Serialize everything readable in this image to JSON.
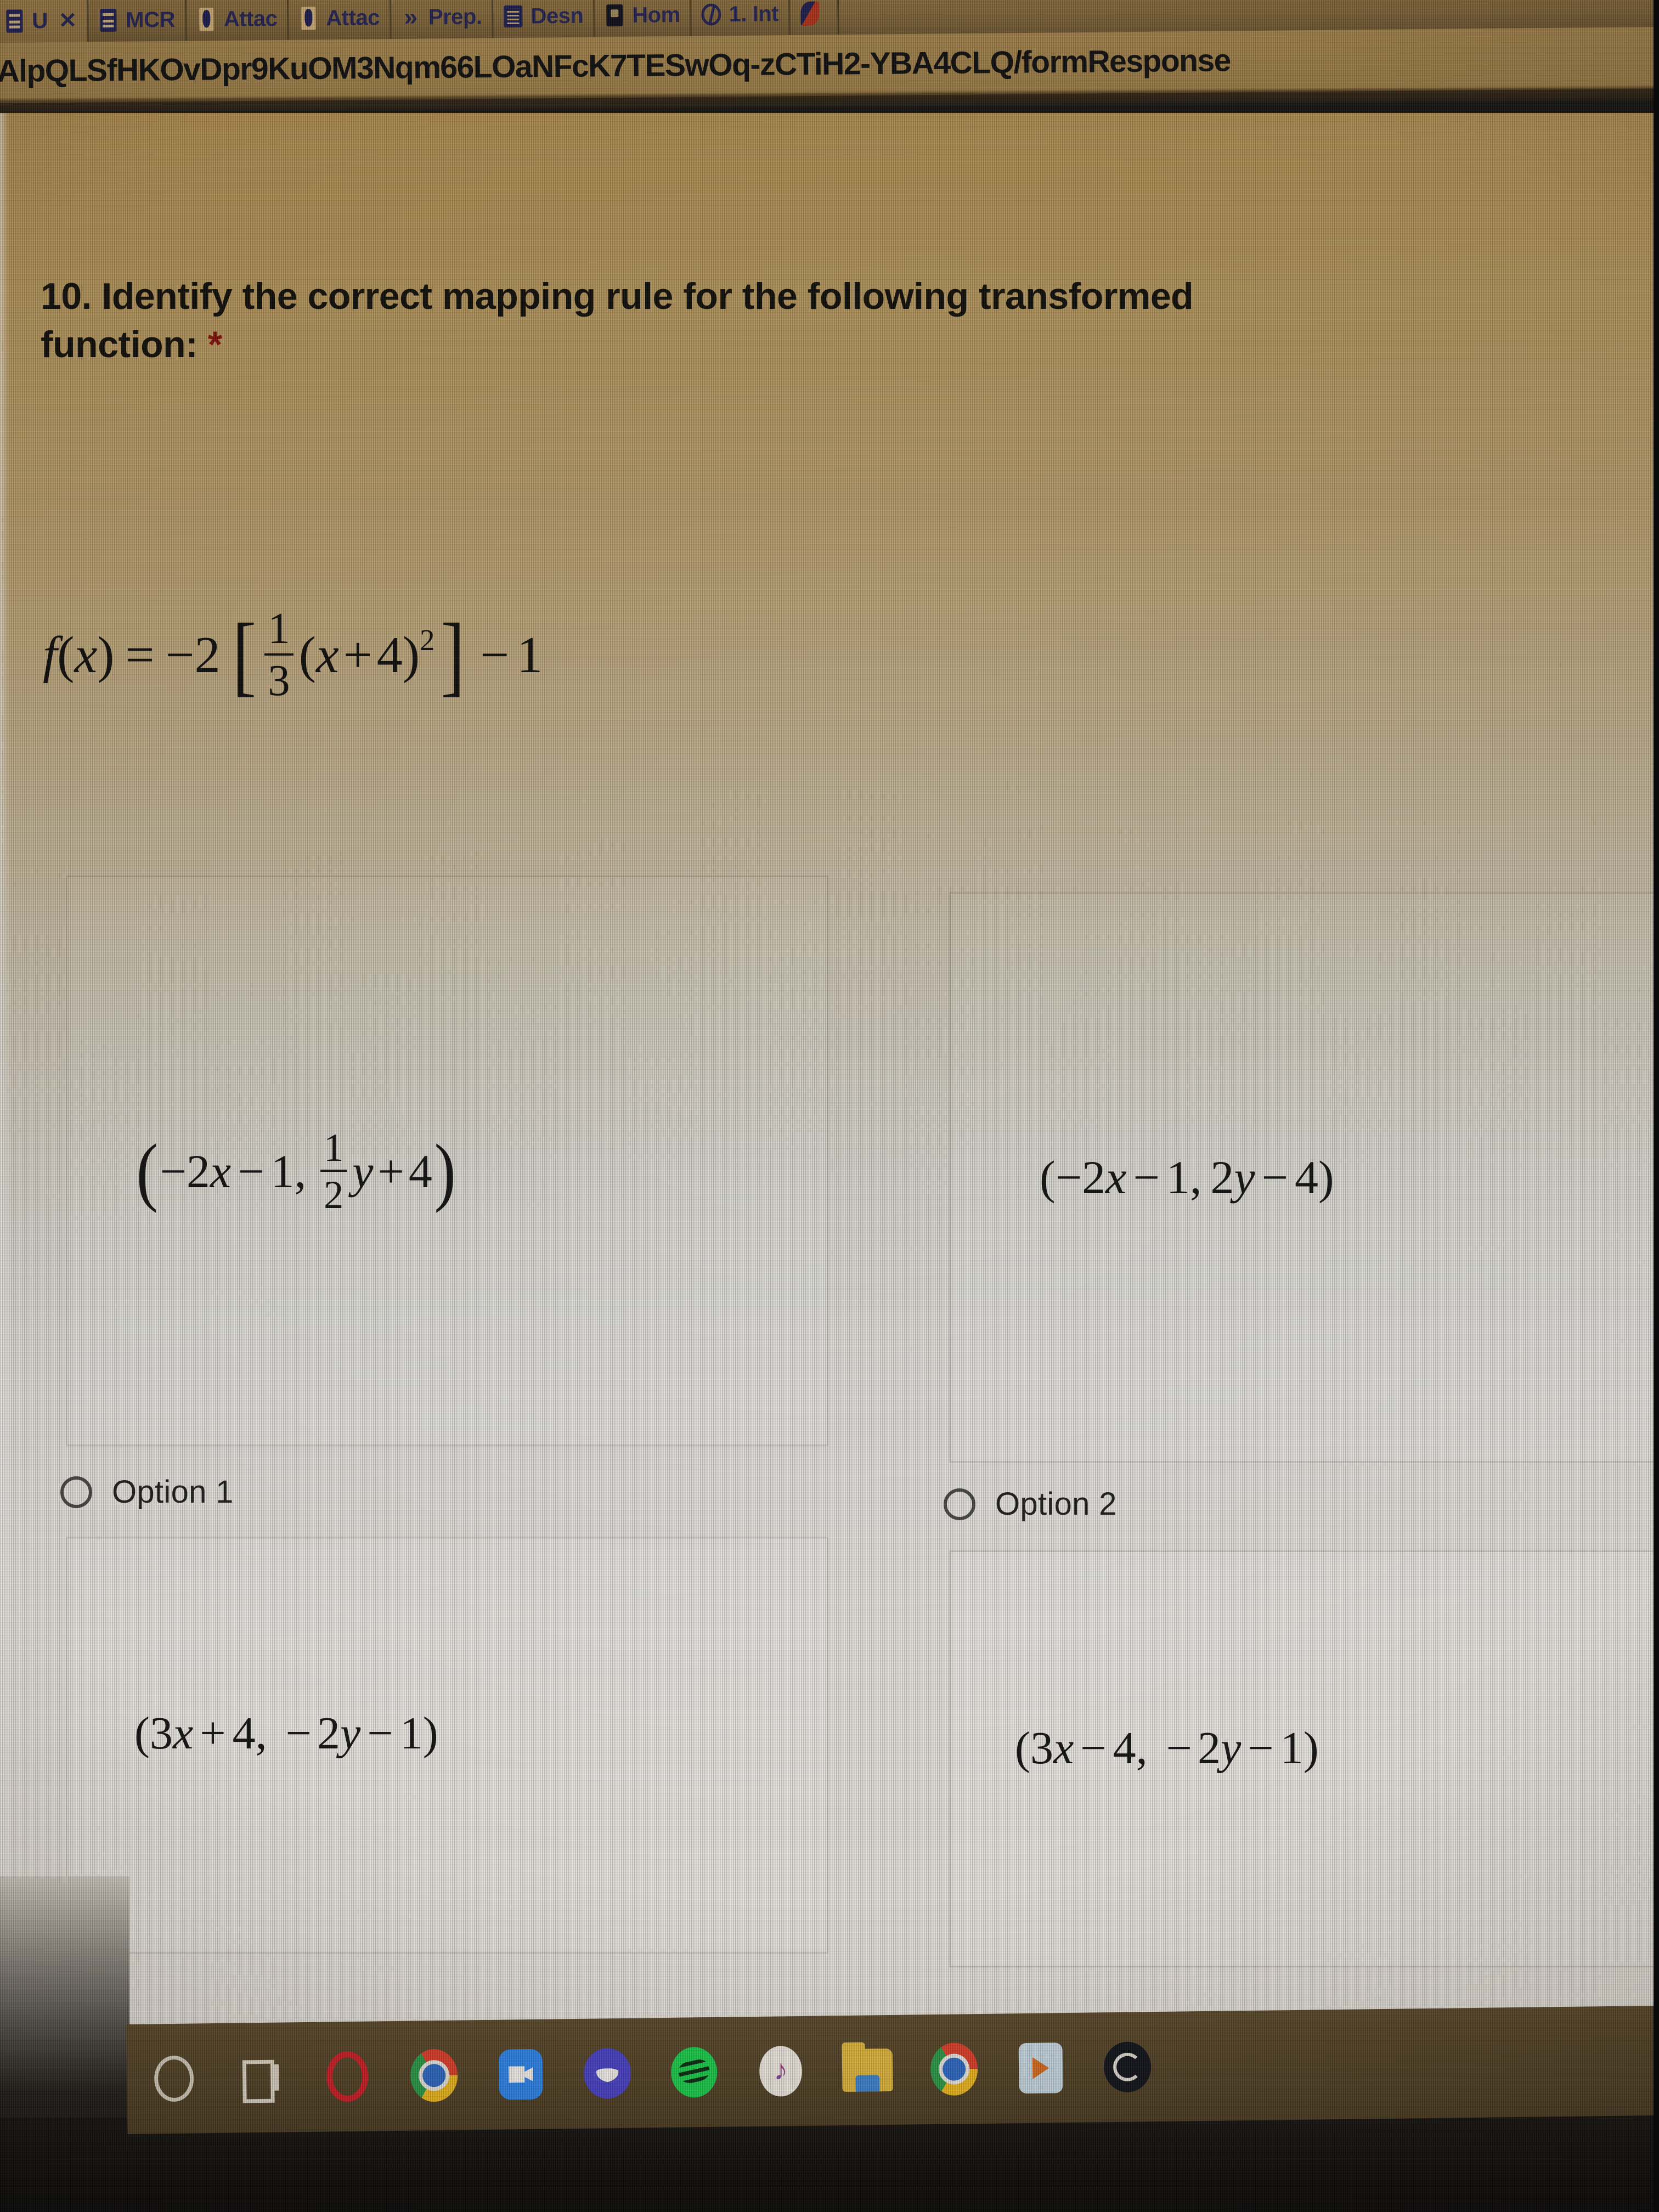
{
  "browser": {
    "tabs": [
      {
        "label": "U",
        "favicon": "form-icon",
        "close_label": "✕",
        "active": true
      },
      {
        "label": "MCR",
        "favicon": "form-icon",
        "close_label": "",
        "active": false
      },
      {
        "label": "Attac",
        "favicon": "document-icon",
        "close_label": "",
        "active": false
      },
      {
        "label": "Attac",
        "favicon": "document-icon",
        "close_label": "",
        "active": false
      },
      {
        "label": "Prep.",
        "favicon": "chevron-double-right-icon",
        "close_label": "",
        "active": false
      },
      {
        "label": "Desn",
        "favicon": "spreadsheet-icon",
        "close_label": "",
        "active": false
      },
      {
        "label": "Hom",
        "favicon": "dark-app-icon",
        "close_label": "",
        "active": false
      },
      {
        "label": "1. Int",
        "favicon": "globe-icon",
        "close_label": "",
        "active": false
      },
      {
        "label": "",
        "favicon": "red-app-icon",
        "close_label": "",
        "active": false
      }
    ],
    "url": "AlpQLSfHKOvDpr9KuOM3Nqm66LOaNFcK7TESwOq-zCTiH2-YBA4CLQ/formResponse"
  },
  "form": {
    "question_number": "10.",
    "question_text": "10. Identify the correct mapping rule for the following transformed",
    "question_text_line2": "function:",
    "required_marker": "*",
    "equation": {
      "lhs_f": "f",
      "lhs_open": "(",
      "lhs_var": "x",
      "lhs_close": ")",
      "equals": "=",
      "coefficient": "−2",
      "bracket_open": "[",
      "frac_num": "1",
      "frac_den": "3",
      "inner_open": "(",
      "inner_var": "x",
      "inner_plus": "+",
      "inner_const": "4",
      "inner_close": ")",
      "exponent": "2",
      "bracket_close": "]",
      "tail_minus": "−",
      "tail_const": "1"
    },
    "options": [
      {
        "id": "option-1",
        "label": "Option 1",
        "selected": false,
        "image_text": "(−2x − 1,  ½y + 4)",
        "parts": {
          "open": "(",
          "x_term": "−2",
          "x_var": "x",
          "x_minus": "−",
          "x_const": "1,",
          "frac_num": "1",
          "frac_den": "2",
          "y_var": "y",
          "y_plus": "+",
          "y_const": "4",
          "close": ")"
        }
      },
      {
        "id": "option-2",
        "label": "Option 2",
        "selected": false,
        "image_text": "(−2x − 1, 2y − 4)",
        "parts": {
          "open": "(",
          "x_term": "−2",
          "x_var": "x",
          "x_minus": "−",
          "x_const": "1,",
          "y_coef": "2",
          "y_var": "y",
          "y_minus": "−",
          "y_const": "4",
          "close": ")"
        }
      },
      {
        "id": "option-3",
        "label": "",
        "selected": false,
        "image_text": "(3x + 4,  − 2y − 1)",
        "parts": {
          "open": "(",
          "x_coef": "3",
          "x_var": "x",
          "x_plus": "+",
          "x_const": "4,",
          "y_minus1": "−",
          "y_coef": "2",
          "y_var": "y",
          "y_minus2": "−",
          "y_const": "1",
          "close": ")"
        }
      },
      {
        "id": "option-4",
        "label": "",
        "selected": false,
        "image_text": "(3x − 4,  − 2y − 1)",
        "parts": {
          "open": "(",
          "x_coef": "3",
          "x_var": "x",
          "x_minus": "−",
          "x_const": "4,",
          "y_minus1": "−",
          "y_coef": "2",
          "y_var": "y",
          "y_minus2": "−",
          "y_const": "1",
          "close": ")"
        }
      }
    ]
  },
  "taskbar": {
    "items": [
      {
        "name": "search-icon"
      },
      {
        "name": "task-view-icon"
      },
      {
        "name": "opera-icon"
      },
      {
        "name": "chrome-icon"
      },
      {
        "name": "zoom-icon"
      },
      {
        "name": "discord-icon"
      },
      {
        "name": "spotify-icon"
      },
      {
        "name": "apple-music-icon"
      },
      {
        "name": "file-explorer-icon"
      },
      {
        "name": "chrome-secondary-icon"
      },
      {
        "name": "media-player-icon"
      },
      {
        "name": "app-icon"
      }
    ]
  },
  "colors": {
    "required_red": "#b31412",
    "page_background": "#f2f0ec",
    "text": "#141414",
    "card_border": "#d9d6d0"
  }
}
